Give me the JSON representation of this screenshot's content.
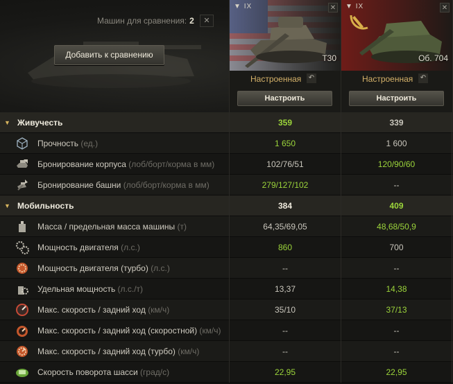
{
  "header": {
    "count_label": "Машин для сравнения:",
    "count_value": "2",
    "clear_icon": "close-icon",
    "add_button": "Добавить к сравнению"
  },
  "tanks": [
    {
      "tier": "IX",
      "name": "T30",
      "flag": "usa",
      "status": "Настроенная",
      "setup_button": "Настроить"
    },
    {
      "tier": "IX",
      "name": "Об. 704",
      "flag": "ussr",
      "status": "Настроенная",
      "setup_button": "Настроить"
    }
  ],
  "colors": {
    "better": "#9cd53b",
    "neutral": "#c9c6bc",
    "accent": "#d5b26a"
  },
  "sections": [
    {
      "title": "Живучесть",
      "values": [
        "359",
        "339"
      ],
      "rows": [
        {
          "icon": "hp-cube-icon",
          "label": "Прочность",
          "unit": "(ед.)",
          "values": [
            "1 650",
            "1 600"
          ]
        },
        {
          "icon": "hull-armor-icon",
          "label": "Бронирование корпуса",
          "unit": "(лоб/борт/корма в мм)",
          "values": [
            "102/76/51",
            "120/90/60"
          ]
        },
        {
          "icon": "turret-armor-icon",
          "label": "Бронирование башни",
          "unit": "(лоб/борт/корма в мм)",
          "values": [
            "279/127/102",
            "--"
          ]
        }
      ]
    },
    {
      "title": "Мобильность",
      "values": [
        "384",
        "409"
      ],
      "rows": [
        {
          "icon": "weight-icon",
          "label": "Масса / предельная масса машины",
          "unit": "(т)",
          "values": [
            "64,35/69,05",
            "48,68/50,9"
          ]
        },
        {
          "icon": "engine-gears-icon",
          "label": "Мощность двигателя",
          "unit": "(л.с.)",
          "values": [
            "860",
            "700"
          ]
        },
        {
          "icon": "engine-turbo-icon",
          "label": "Мощность двигателя (турбо)",
          "unit": "(л.с.)",
          "values": [
            "--",
            "--"
          ]
        },
        {
          "icon": "specific-power-icon",
          "label": "Удельная мощность",
          "unit": "(л.с./т)",
          "values": [
            "13,37",
            "14,38"
          ]
        },
        {
          "icon": "speed-gauge-icon",
          "label": "Макс. скорость / задний ход",
          "unit": "(км/ч)",
          "values": [
            "35/10",
            "37/13"
          ]
        },
        {
          "icon": "speed-fast-icon",
          "label": "Макс. скорость / задний ход (скоростной)",
          "unit": "(км/ч)",
          "values": [
            "--",
            "--"
          ]
        },
        {
          "icon": "speed-turbo-icon",
          "label": "Макс. скорость / задний ход (турбо)",
          "unit": "(км/ч)",
          "values": [
            "--",
            "--"
          ]
        },
        {
          "icon": "traverse-icon",
          "label": "Скорость поворота шасси",
          "unit": "(град/с)",
          "values": [
            "22,95",
            "22,95"
          ]
        }
      ]
    }
  ]
}
